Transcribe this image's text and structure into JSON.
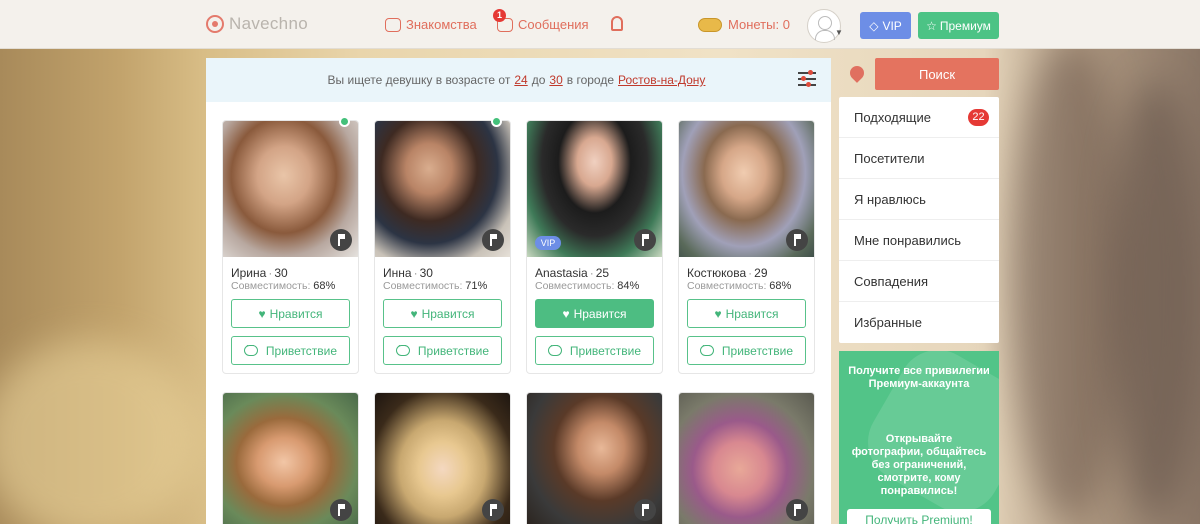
{
  "header": {
    "logo_text": "Navechno",
    "nav": {
      "dating": "Знакомства",
      "messages": "Сообщения",
      "messages_badge": "1"
    },
    "coins_label": "Монеты: 0",
    "vip_label": "VIP",
    "premium_label": "Премиум"
  },
  "search": {
    "prefix": "Вы ищете девушку в возрасте от",
    "age_from": "24",
    "to_word": "до",
    "age_to": "30",
    "city_prefix": "в городе",
    "city": "Ростов-на-Дону",
    "button": "Поиск"
  },
  "profiles": [
    {
      "name": "Ирина",
      "age": "30",
      "compat_label": "Совместимость:",
      "compat": "68%",
      "online": true,
      "vip": false,
      "liked": false
    },
    {
      "name": "Инна",
      "age": "30",
      "compat_label": "Совместимость:",
      "compat": "71%",
      "online": true,
      "vip": false,
      "liked": false
    },
    {
      "name": "Anastasia",
      "age": "25",
      "compat_label": "Совместимость:",
      "compat": "84%",
      "online": false,
      "vip": true,
      "liked": true
    },
    {
      "name": "Костюкова",
      "age": "29",
      "compat_label": "Совместимость:",
      "compat": "68%",
      "online": false,
      "vip": false,
      "liked": false
    }
  ],
  "card_actions": {
    "like": "Нравится",
    "greet": "Приветствие",
    "vip_tag": "VIP"
  },
  "sidebar": {
    "items": [
      {
        "label": "Подходящие",
        "badge": "22"
      },
      {
        "label": "Посетители"
      },
      {
        "label": "Я нравлюсь"
      },
      {
        "label": "Мне понравились"
      },
      {
        "label": "Совпадения"
      },
      {
        "label": "Избранные"
      }
    ]
  },
  "promo": {
    "title": "Получите все привилегии Премиум-аккаунта",
    "text": "Открывайте фотографии, общайтесь без ограничений, смотрите, кому понравились!",
    "button": "Получить Premium!"
  },
  "colors": {
    "accent_red": "#e4735f",
    "accent_green": "#4dbd82",
    "vip_blue": "#6d8ee6"
  }
}
